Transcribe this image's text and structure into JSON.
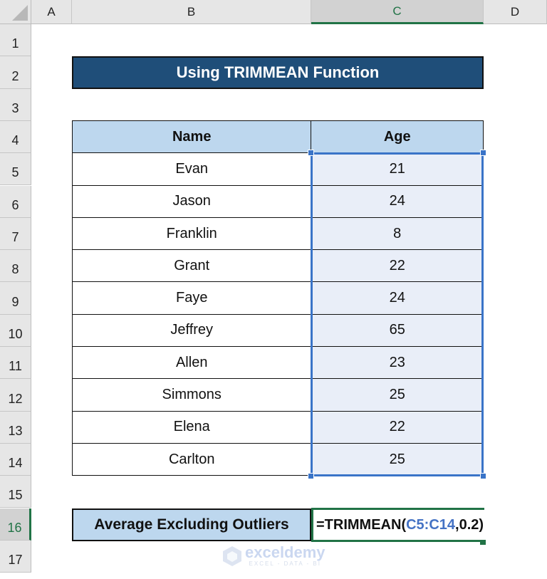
{
  "sheet": {
    "columns": [
      "A",
      "B",
      "C",
      "D"
    ],
    "selected_column": "C",
    "rows": [
      "1",
      "2",
      "3",
      "4",
      "5",
      "6",
      "7",
      "8",
      "9",
      "10",
      "11",
      "12",
      "13",
      "14",
      "15",
      "16",
      "17"
    ],
    "selected_row": "16"
  },
  "title": "Using TRIMMEAN Function",
  "table": {
    "headers": {
      "name": "Name",
      "age": "Age"
    },
    "rows": [
      {
        "name": "Evan",
        "age": "21"
      },
      {
        "name": "Jason",
        "age": "24"
      },
      {
        "name": "Franklin",
        "age": "8"
      },
      {
        "name": "Grant",
        "age": "22"
      },
      {
        "name": "Faye",
        "age": "24"
      },
      {
        "name": "Jeffrey",
        "age": "65"
      },
      {
        "name": "Allen",
        "age": "23"
      },
      {
        "name": "Simmons",
        "age": "25"
      },
      {
        "name": "Elena",
        "age": "22"
      },
      {
        "name": "Carlton",
        "age": "25"
      }
    ]
  },
  "result": {
    "label": "Average Excluding Outliers",
    "formula_prefix": "=TRIMMEAN(",
    "formula_ref": "C5:C14",
    "formula_suffix": ",0.2)"
  },
  "colors": {
    "title_bg": "#1f4e79",
    "header_bg": "#bdd7ee",
    "selection": "#3a74c8",
    "active_cell": "#217346",
    "ref_color": "#4472c4"
  },
  "watermark": {
    "brand": "exceldemy",
    "tagline": "EXCEL - DATA - BI"
  }
}
